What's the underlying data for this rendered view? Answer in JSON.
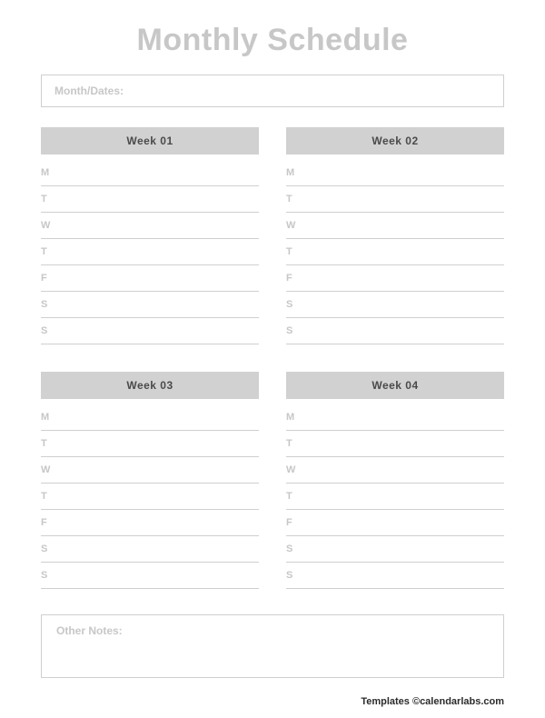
{
  "title": "Monthly Schedule",
  "month_label": "Month/Dates:",
  "days": [
    "M",
    "T",
    "W",
    "T",
    "F",
    "S",
    "S"
  ],
  "weeks": [
    {
      "label": "Week 01"
    },
    {
      "label": "Week 02"
    },
    {
      "label": "Week 03"
    },
    {
      "label": "Week 04"
    }
  ],
  "notes_label": "Other Notes:",
  "footer": "Templates ©calendarlabs.com"
}
